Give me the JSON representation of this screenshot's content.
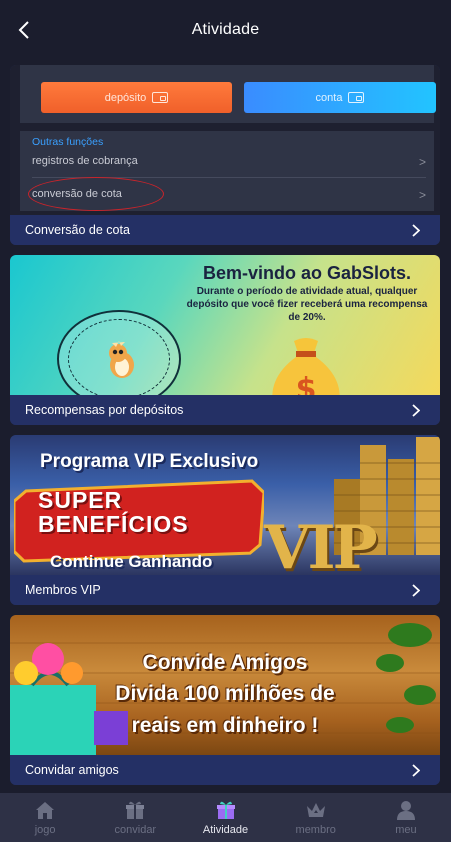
{
  "header": {
    "title": "Atividade"
  },
  "cards": [
    {
      "label": "Conversão de cota",
      "screenshot": {
        "deposit_button": "depósito",
        "account_button": "conta",
        "section_title": "Outras funções",
        "rows": [
          "registros de cobrança",
          "conversão de cota"
        ],
        "row_arrow": ">"
      }
    },
    {
      "label": "Recompensas por depósitos",
      "banner": {
        "title": "Bem-vindo ao GabSlots.",
        "body": "Durante o período de atividade atual, qualquer depósito que você fizer receberá uma recompensa de 20%."
      }
    },
    {
      "label": "Membros VIP",
      "banner": {
        "title": "Programa VIP Exclusivo",
        "line1": "SUPER",
        "line2": "BENEFÍCIOS",
        "subtitle": "Continue Ganhando",
        "logo": "VIP"
      }
    },
    {
      "label": "Convidar amigos",
      "banner": {
        "line1": "Convide Amigos",
        "line2": "Divida 100 milhões de",
        "line3": "reais em dinheiro !"
      }
    }
  ],
  "tabs": [
    {
      "label": "jogo",
      "icon": "home-icon"
    },
    {
      "label": "convidar",
      "icon": "gift-icon"
    },
    {
      "label": "Atividade",
      "icon": "activity-gift-icon",
      "active": true
    },
    {
      "label": "membro",
      "icon": "crown-icon"
    },
    {
      "label": "meu",
      "icon": "user-icon"
    }
  ],
  "colors": {
    "background": "#1b1d2d",
    "card_bar": "#243065",
    "tabbar": "#2e3146",
    "tab_inactive": "#6b6f83",
    "tab_active": "#e7e8ef"
  }
}
